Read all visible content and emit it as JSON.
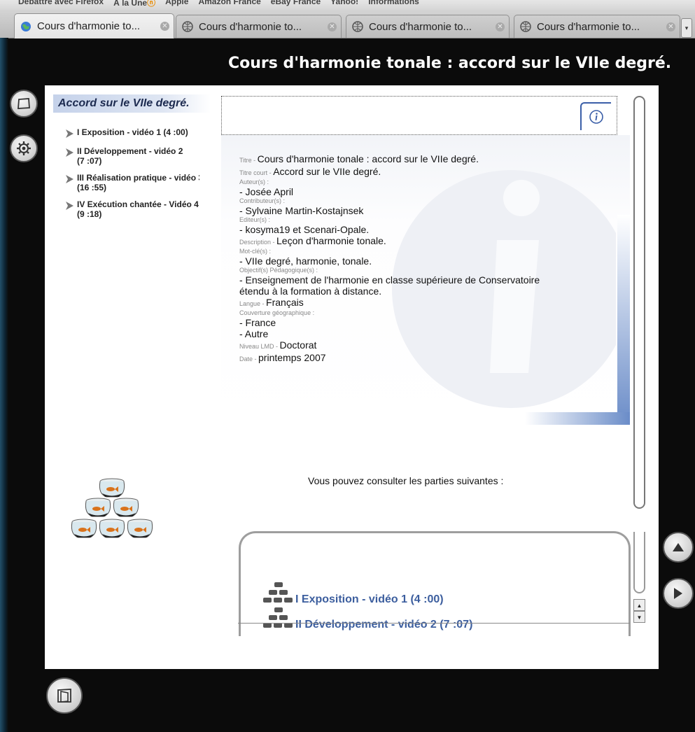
{
  "browser": {
    "bookmarks": [
      "Débattre avec Firefox",
      "À la Une",
      "Apple",
      "Amazon France",
      "eBay France",
      "Yahoo!",
      "Informations"
    ],
    "tabs": [
      {
        "label": "Cours d'harmonie to...",
        "active": true
      },
      {
        "label": "Cours d'harmonie to...",
        "active": false
      },
      {
        "label": "Cours d'harmonie to...",
        "active": false
      },
      {
        "label": "Cours d'harmonie to...",
        "active": false
      }
    ],
    "tab_list_arrow": "▾"
  },
  "page": {
    "title": "Cours d'harmonie tonale : accord sur le VIIe degré."
  },
  "toc": {
    "title": "Accord sur le VIIe degré.",
    "items": [
      {
        "line1": "I Exposition - vidéo 1 (4 :00)",
        "line2": ""
      },
      {
        "line1": "II Développement - vidéo 2",
        "line2": "(7 :07)"
      },
      {
        "line1": "III Réalisation pratique - vidéo 3",
        "line2": "(16 :55)"
      },
      {
        "line1": "IV Exécution chantée - Vidéo 4",
        "line2": "(9 :18)"
      }
    ]
  },
  "metadata": {
    "titre_label": "Titre - ",
    "titre": "Cours d'harmonie tonale : accord sur le VIIe degré.",
    "titre_court_label": "Titre court - ",
    "titre_court": "Accord sur le VIIe degré.",
    "auteurs_label": "Auteur(s) :",
    "auteur": "- Josée April",
    "contributeurs_label": "Contributeur(s) :",
    "contributeur": "- Sylvaine Martin-Kostajnsek",
    "editeurs_label": "Editeur(s) :",
    "editeur": "- kosyma19 et Scenari-Opale.",
    "description_label": "Description - ",
    "description": "Leçon d'harmonie tonale.",
    "motscles_label": "Mot-clé(s) :",
    "motscles": "- VIIe degré, harmonie, tonale.",
    "objectifs_label": "Objectif(s) Pédagogique(s) :",
    "objectif_1": "- Enseignement de l'harmonie en classe supérieure de Conservatoire",
    "objectif_2": "étendu à la formation à distance.",
    "langue_label": "Langue - ",
    "langue": "Français",
    "couverture_label": "Couverture géographique :",
    "couverture_1": "- France",
    "couverture_2": "- Autre",
    "niveau_label": "Niveau LMD - ",
    "niveau": "Doctorat",
    "date_label": "Date - ",
    "date": "printemps 2007"
  },
  "parts": {
    "intro": "Vous pouvez consulter les parties suivantes :",
    "links": [
      "I Exposition - vidéo 1 (4 :00)",
      "II Développement - vidéo 2 (7 :07)"
    ]
  },
  "colors": {
    "toc_title_bg": "#c5d2ea",
    "link": "#3c5e9e",
    "accent": "#6a8cc8"
  }
}
